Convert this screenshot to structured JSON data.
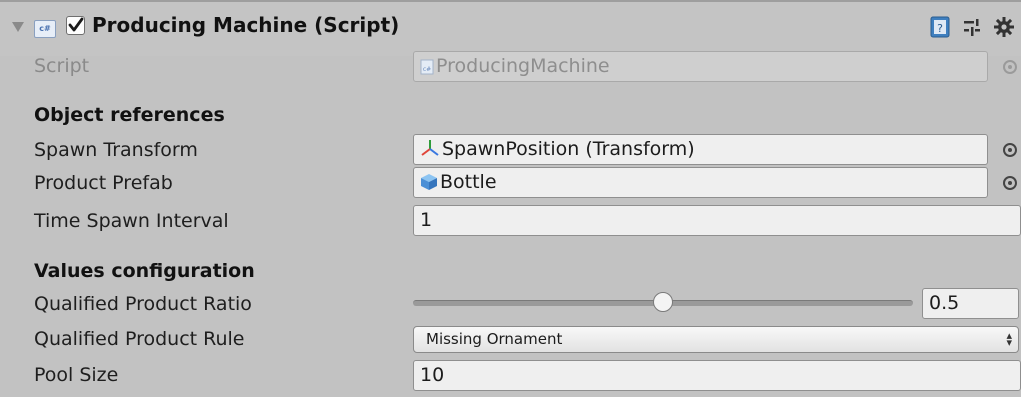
{
  "component": {
    "title": "Producing Machine (Script)",
    "enabled": true
  },
  "icons": {
    "foldout": "foldout-arrow-down",
    "script_type": "cs-script-icon",
    "help": "help-book-icon",
    "presets": "presets-sliders-icon",
    "settings": "gear-icon",
    "object_picker": "object-picker-icon"
  },
  "rows": {
    "script": {
      "label": "Script",
      "value": "ProducingMachine"
    },
    "object_references_header": "Object references",
    "spawn_transform": {
      "label": "Spawn Transform",
      "value": "SpawnPosition (Transform)"
    },
    "product_prefab": {
      "label": "Product Prefab",
      "value": "Bottle"
    },
    "time_spawn_interval": {
      "label": "Time Spawn Interval",
      "value": "1"
    },
    "values_configuration_header": "Values configuration",
    "qualified_product_ratio": {
      "label": "Qualified Product Ratio",
      "value": "0.5",
      "slider_fraction": 0.5
    },
    "qualified_product_rule": {
      "label": "Qualified Product Rule",
      "value": "Missing Ornament"
    },
    "pool_size": {
      "label": "Pool Size",
      "value": "10"
    }
  },
  "colors": {
    "panel_background": "#c2c2c2",
    "field_background": "#efefef",
    "transform_icon_red": "#e0453a",
    "transform_icon_blue": "#3a78e0",
    "prefab_icon_blue": "#5aa0e6"
  }
}
